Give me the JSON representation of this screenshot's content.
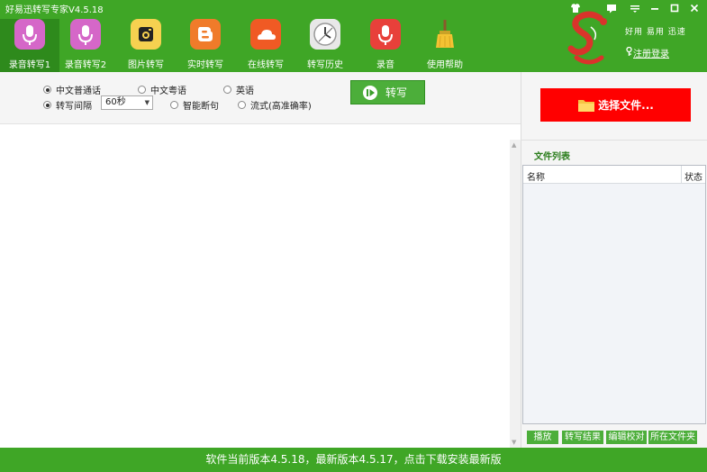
{
  "window": {
    "title": "好易迅转写专家V4.5.18"
  },
  "toolbar": {
    "items": [
      {
        "label": "录音转写1",
        "icon": "microphone-icon",
        "color": "#d567c8"
      },
      {
        "label": "录音转写2",
        "icon": "microphone-icon",
        "color": "#d567c8"
      },
      {
        "label": "图片转写",
        "icon": "camera-icon",
        "color": "#f6d150"
      },
      {
        "label": "实时转写",
        "icon": "blogger-icon",
        "color": "#f07b2a"
      },
      {
        "label": "在线转写",
        "icon": "cloud-icon",
        "color": "#f05a24"
      },
      {
        "label": "转写历史",
        "icon": "clock-icon",
        "color": "#e8e8e8"
      },
      {
        "label": "录音",
        "icon": "microphone-icon",
        "color": "#e8403a"
      },
      {
        "label": "使用帮助",
        "icon": "broom-icon",
        "color": "#f4c233"
      }
    ]
  },
  "brand": {
    "slogan": "好用 易用 迅速",
    "login_label": "注册登录",
    "logo_color": "#d9342b"
  },
  "options": {
    "lang_mandarin": "中文普通话",
    "lang_cantonese": "中文粤语",
    "lang_english": "英语",
    "interval_label": "转写间隔",
    "interval_value": "60秒",
    "smart_break": "智能断句",
    "streaming": "流式(高准确率)",
    "transcribe_label": "转写"
  },
  "file_panel": {
    "choose_file_label": "选择文件...",
    "list_title": "文件列表",
    "col_name": "名称",
    "col_status": "状态",
    "actions": [
      "播放",
      "转写结果",
      "编辑校对",
      "所在文件夹"
    ]
  },
  "status": {
    "message": "软件当前版本4.5.18，最新版本4.5.17，点击下载安装最新版"
  },
  "colors": {
    "accent": "#3fa626",
    "button_green": "#4cae3a",
    "choose_file_red": "#ff0000"
  }
}
